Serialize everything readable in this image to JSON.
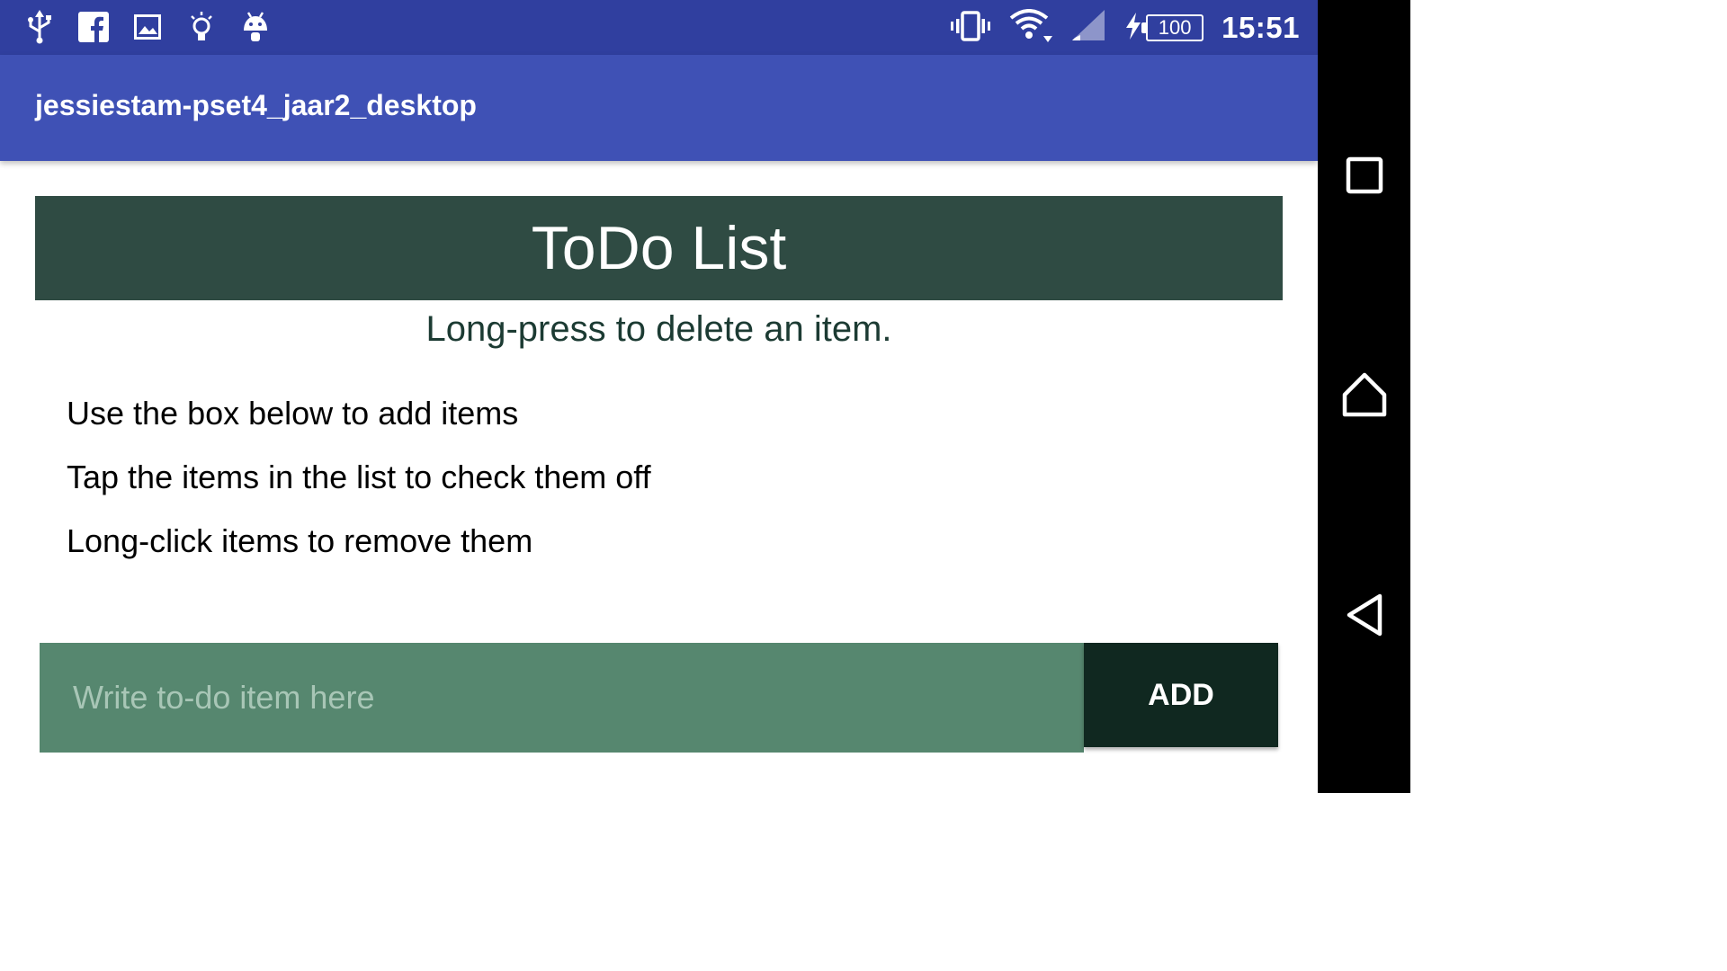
{
  "status_bar": {
    "icons_left": [
      "usb-icon",
      "facebook-icon",
      "image-icon",
      "lightbulb-icon",
      "android-icon"
    ],
    "icons_right": [
      "vibrate-icon",
      "wifi-icon",
      "cell-signal-icon",
      "charging-icon"
    ],
    "battery_level": "100",
    "time": "15:51",
    "background": "#303f9f"
  },
  "app_bar": {
    "title": "jessiestam-pset4_jaar2_desktop",
    "background": "#3f51b5"
  },
  "header": {
    "title": "ToDo List",
    "background": "#2f4b43"
  },
  "hint": "Long-press to delete an item.",
  "todo_items": [
    "Use the box below to add items",
    "Tap the items in the list to check them off",
    "Long-click items to remove them"
  ],
  "input": {
    "placeholder": "Write to-do item here",
    "value": "",
    "background": "#56876f"
  },
  "add_button": {
    "label": "ADD",
    "background": "#102820"
  },
  "nav_bar": {
    "buttons": [
      "recents-icon",
      "home-icon",
      "back-icon"
    ]
  }
}
